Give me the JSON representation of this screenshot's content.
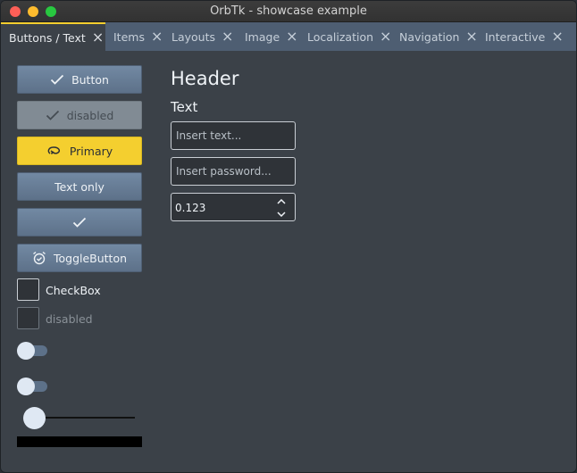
{
  "window": {
    "title": "OrbTk - showcase example"
  },
  "tabs": [
    {
      "label": "Buttons / Text"
    },
    {
      "label": "Items"
    },
    {
      "label": "Layouts"
    },
    {
      "label": "Image"
    },
    {
      "label": "Localization"
    },
    {
      "label": "Navigation"
    },
    {
      "label": "Interactive"
    }
  ],
  "buttons": {
    "button": "Button",
    "disabled": "disabled",
    "primary": "Primary",
    "text_only": "Text only",
    "toggle": "ToggleButton"
  },
  "checkboxes": {
    "enabled_label": "CheckBox",
    "disabled_label": "disabled"
  },
  "slider": {
    "value_fraction": 0.0
  },
  "progress": {
    "value_fraction": 0.0
  },
  "text": {
    "header": "Header",
    "subheader": "Text"
  },
  "inputs": {
    "text_placeholder": "Insert text...",
    "password_placeholder": "Insert password...",
    "numeric_value": "0.123"
  },
  "colors": {
    "accent": "#f4cf2f",
    "tabbar": "#4e5e72",
    "background": "#3b4148"
  }
}
